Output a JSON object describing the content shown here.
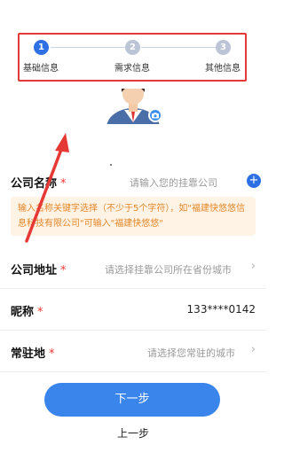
{
  "stepper": {
    "steps": [
      {
        "number": "1",
        "label": "基础信息"
      },
      {
        "number": "2",
        "label": "需求信息"
      },
      {
        "number": "3",
        "label": "其他信息"
      }
    ],
    "current_step": 1,
    "active_color": "#2f6fe4",
    "inactive_color": "#bcc5d6"
  },
  "form": {
    "company_name": {
      "label": "公司名称",
      "required_mark": "*",
      "placeholder": "请输入您的挂靠公司"
    },
    "notice": "输入名称关键字选择（不少于5个字符），如\"福建快悠悠信息科技有限公司\"可输入\"福建快悠悠\"",
    "company_address": {
      "label": "公司地址",
      "required_mark": "*",
      "placeholder": "请选择挂靠公司所在省份城市"
    },
    "nickname": {
      "label": "昵称",
      "required_mark": "*",
      "value": "133****0142"
    },
    "residence": {
      "label": "常驻地",
      "required_mark": "*",
      "placeholder": "请选择您常驻的城市"
    }
  },
  "icons": {
    "chevron": "›",
    "plus": "+"
  },
  "actions": {
    "next_label": "下一步",
    "prev_label": "上一步"
  },
  "colors": {
    "primary": "#3a85ec",
    "required": "#e53935",
    "notice_bg": "#fff3e6",
    "notice_text": "#e38728"
  }
}
